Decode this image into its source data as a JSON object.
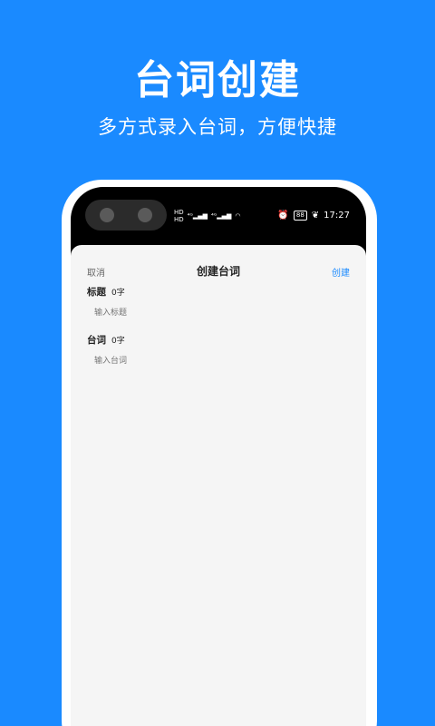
{
  "promo": {
    "title": "台词创建",
    "subtitle": "多方式录入台词，方便快捷"
  },
  "status_bar": {
    "left_icons": [
      "HD",
      "4G",
      "4G",
      "wifi"
    ],
    "time": "17:27",
    "battery": "88"
  },
  "app": {
    "nav": {
      "cancel_label": "取消",
      "title": "创建台词",
      "create_label": "创建"
    },
    "title_field": {
      "label": "标题",
      "count": "0字",
      "placeholder": "输入标题"
    },
    "line_field": {
      "label": "台词",
      "count": "0字",
      "placeholder": "输入台词"
    }
  },
  "colors": {
    "background": "#1a8aff",
    "accent": "#1a8aff",
    "sheet": "#f5f5f5"
  }
}
